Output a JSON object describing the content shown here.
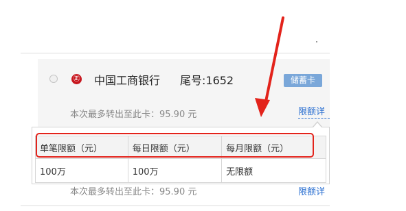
{
  "bank_card": {
    "bank_logo_glyph": "㊣",
    "bank_name": "中国工商银行",
    "card_tail": "尾号:1652",
    "card_type": "储蓄卡",
    "transfer_max": "本次最多转出至此卡：95.90 元",
    "limit_link": "限额详",
    "ghost_transfer_max": "本次最多转出至此卡：95.90 元",
    "ghost_limit_link": "限额详"
  },
  "limit_table": {
    "headers": [
      "单笔限额（元）",
      "每日限额（元）",
      "每月限额（元）"
    ],
    "row": [
      "100万",
      "100万",
      "无限额"
    ]
  },
  "colors": {
    "highlight": "#e3231b",
    "arrow": "#e3231b",
    "bank_logo": "#c7161e",
    "card_type_badge": "#7aa7d9",
    "link": "#2a6fd1"
  }
}
